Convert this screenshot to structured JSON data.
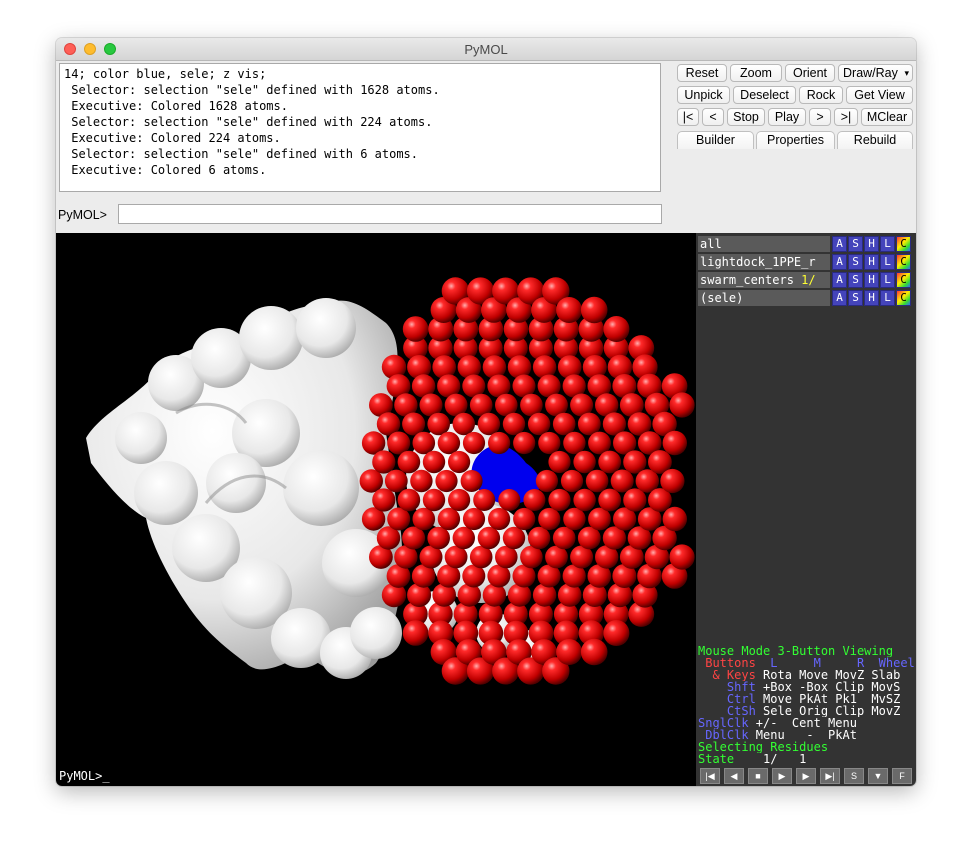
{
  "window": {
    "title": "PyMOL"
  },
  "log": {
    "lines": [
      "14; color blue, sele; z vis;",
      " Selector: selection \"sele\" defined with 1628 atoms.",
      " Executive: Colored 1628 atoms.",
      " Selector: selection \"sele\" defined with 224 atoms.",
      " Executive: Colored 224 atoms.",
      " Selector: selection \"sele\" defined with 6 atoms.",
      " Executive: Colored 6 atoms."
    ]
  },
  "command": {
    "label": "PyMOL>",
    "value": ""
  },
  "toolbar": {
    "row1": [
      "Reset",
      "Zoom",
      "Orient",
      "Draw/Ray"
    ],
    "row2": [
      "Unpick",
      "Deselect",
      "Rock",
      "Get View"
    ],
    "row3": [
      "|<",
      "<",
      "Stop",
      "Play",
      ">",
      ">|",
      "MClear"
    ],
    "tabs": [
      "Builder",
      "Properties",
      "Rebuild"
    ]
  },
  "objects": [
    {
      "name": "all",
      "extra": ""
    },
    {
      "name": "lightdock_1PPE_r",
      "extra": ""
    },
    {
      "name": "swarm_centers ",
      "extra": "1/"
    },
    {
      "name": "(sele)",
      "extra": ""
    }
  ],
  "ashlc": [
    "A",
    "S",
    "H",
    "L",
    "C"
  ],
  "mouse_mode": {
    "title": "Mouse Mode 3-Button Viewing",
    "header": {
      "buttons": " Buttons",
      "l": "  L",
      "m": "     M",
      "r": "     R",
      "wheel": "  Wheel"
    },
    "rows": [
      {
        "key": "  & Keys",
        "vals": " Rota Move MovZ Slab"
      },
      {
        "key": "    Shft",
        "vals": " +Box -Box Clip MovS"
      },
      {
        "key": "    Ctrl",
        "vals": " Move PkAt Pk1  MvSZ"
      },
      {
        "key": "    CtSh",
        "vals": " Sele Orig Clip MovZ"
      },
      {
        "key": "SnglClk",
        "vals": " +/-  Cent Menu"
      },
      {
        "key": " DblClk",
        "vals": " Menu   -  PkAt"
      }
    ],
    "selecting": "Selecting Residues",
    "state_label": "State",
    "state_value": "    1/   1"
  },
  "bottom": {
    "cmdline": "PyMOL>_"
  },
  "movie_buttons": [
    "|◀",
    "◀",
    "■",
    "▶",
    "▶",
    "▶|",
    "S",
    "▼",
    "F"
  ],
  "colors": {
    "sphere": "#e00000",
    "blue_patch": "#0000ee",
    "surface": "#f2f2f2"
  }
}
